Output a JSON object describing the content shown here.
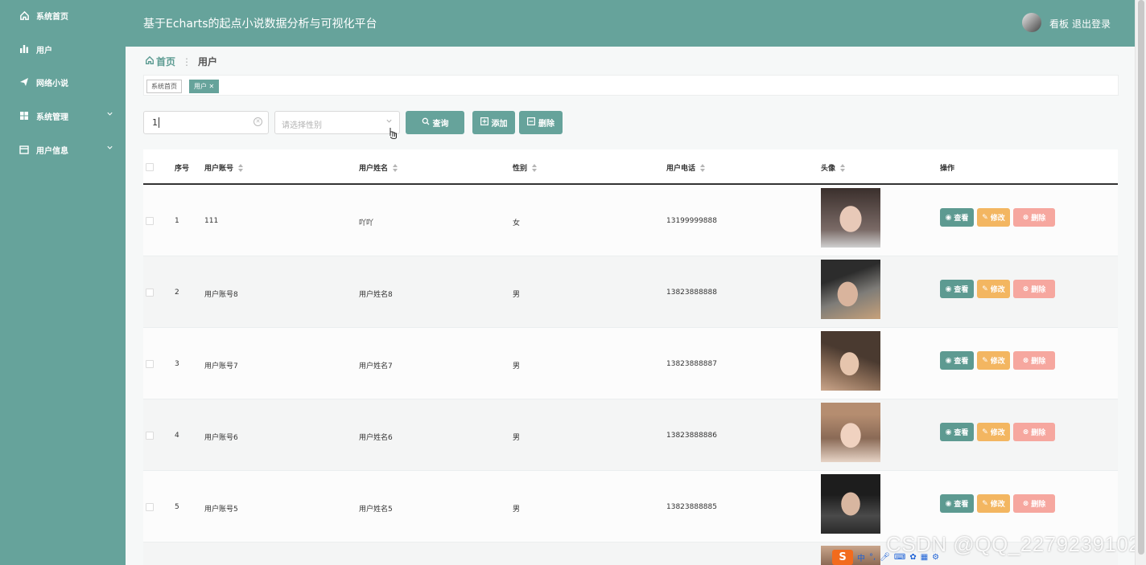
{
  "app_title": "基于Echarts的起点小说数据分析与可视化平台",
  "sidebar": {
    "items": [
      {
        "label": "系统首页",
        "icon": "home-icon"
      },
      {
        "label": "用户",
        "icon": "bar-chart-icon"
      },
      {
        "label": "网络小说",
        "icon": "paper-plane-icon"
      },
      {
        "label": "系统管理",
        "icon": "grid-icon",
        "expandable": true
      },
      {
        "label": "用户信息",
        "icon": "calendar-icon",
        "expandable": true
      }
    ]
  },
  "header": {
    "dashboard_link": "看板",
    "logout_link": "退出登录"
  },
  "breadcrumb": {
    "home": "首页",
    "current": "用户"
  },
  "tabs": [
    {
      "label": "系统首页",
      "active": false
    },
    {
      "label": "用户",
      "active": true
    }
  ],
  "search": {
    "account_value": "1",
    "gender_placeholder": "请选择性别",
    "query_label": "查询",
    "add_label": "添加",
    "delete_label": "删除"
  },
  "table": {
    "columns": [
      "序号",
      "用户账号",
      "用户姓名",
      "性别",
      "用户电话",
      "头像",
      "操作"
    ],
    "rows": [
      {
        "index": "1",
        "account": "111",
        "name": "吖吖",
        "gender": "女",
        "phone": "13199999888"
      },
      {
        "index": "2",
        "account": "用户账号8",
        "name": "用户姓名8",
        "gender": "男",
        "phone": "13823888888"
      },
      {
        "index": "3",
        "account": "用户账号7",
        "name": "用户姓名7",
        "gender": "男",
        "phone": "13823888887"
      },
      {
        "index": "4",
        "account": "用户账号6",
        "name": "用户姓名6",
        "gender": "男",
        "phone": "13823888886"
      },
      {
        "index": "5",
        "account": "用户账号5",
        "name": "用户姓名5",
        "gender": "男",
        "phone": "13823888885"
      }
    ],
    "actions": {
      "view": "查看",
      "edit": "修改",
      "delete": "删除"
    }
  },
  "watermark": "CSDN @QQ_2279239102",
  "ime": {
    "lang": "中",
    "punct": "°,"
  },
  "colors": {
    "theme": "#66a39b",
    "edit": "#f3b661",
    "delete": "#f6a79f",
    "view": "#5d9a91"
  }
}
